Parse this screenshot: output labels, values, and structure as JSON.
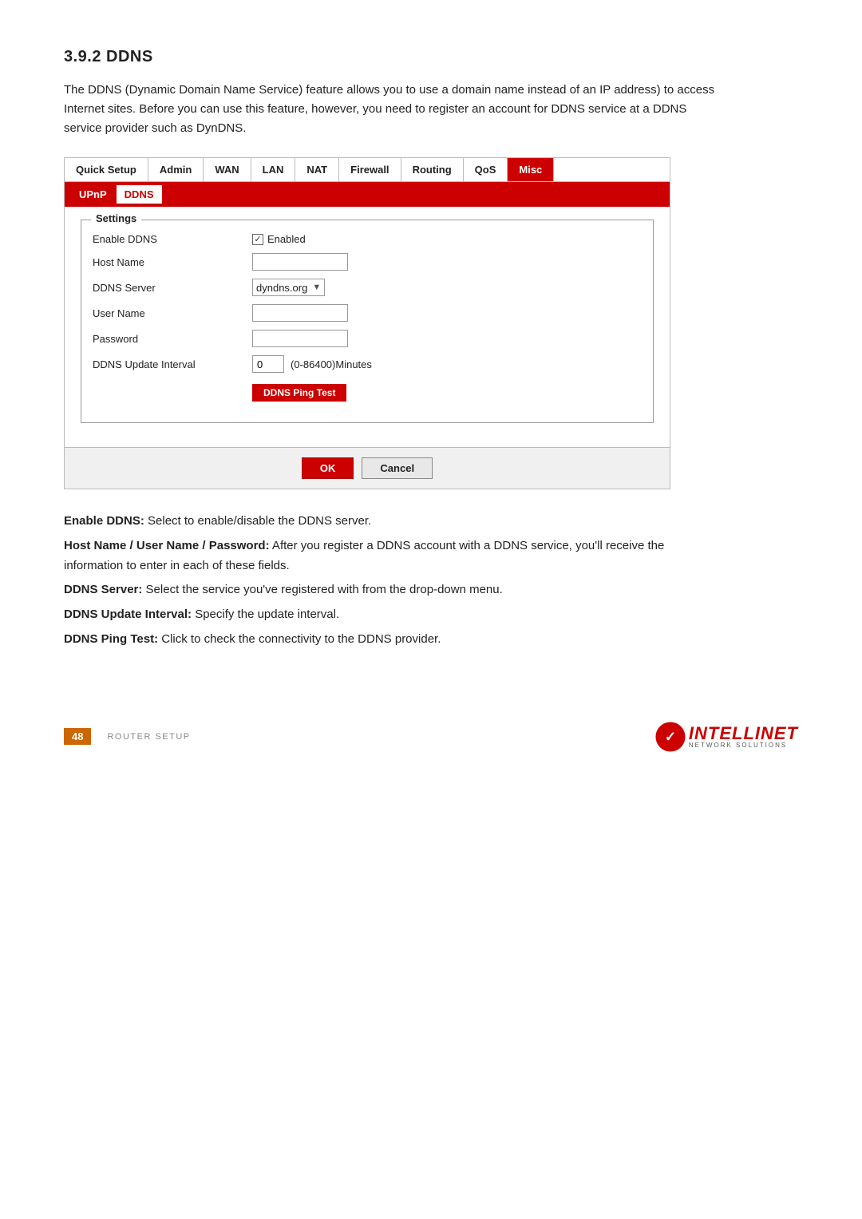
{
  "section": {
    "title": "3.9.2  DDNS",
    "intro": "The DDNS (Dynamic Domain Name Service) feature allows you to use a domain name instead of an IP address) to access Internet sites. Before you can use this feature, however, you need to register an account for DDNS service at a DDNS service provider such as DynDNS."
  },
  "nav": {
    "items": [
      {
        "label": "Quick Setup",
        "active": false
      },
      {
        "label": "Admin",
        "active": false
      },
      {
        "label": "WAN",
        "active": false
      },
      {
        "label": "LAN",
        "active": false
      },
      {
        "label": "NAT",
        "active": false
      },
      {
        "label": "Firewall",
        "active": false
      },
      {
        "label": "Routing",
        "active": false
      },
      {
        "label": "QoS",
        "active": false
      },
      {
        "label": "Misc",
        "active": true
      }
    ]
  },
  "subnav": {
    "items": [
      {
        "label": "UPnP",
        "active": false
      },
      {
        "label": "DDNS",
        "active": true
      }
    ]
  },
  "settings": {
    "legend": "Settings",
    "fields": [
      {
        "label": "Enable DDNS",
        "type": "checkbox",
        "checked": true,
        "checkboxLabel": "Enabled"
      },
      {
        "label": "Host Name",
        "type": "text",
        "value": ""
      },
      {
        "label": "DDNS Server",
        "type": "select",
        "value": "dyndns.org"
      },
      {
        "label": "User Name",
        "type": "text",
        "value": ""
      },
      {
        "label": "Password",
        "type": "password",
        "value": ""
      },
      {
        "label": "DDNS Update Interval",
        "type": "interval",
        "value": "0",
        "hint": "(0-86400)Minutes"
      }
    ],
    "pingButton": "DDNS Ping Test"
  },
  "footer_buttons": {
    "ok": "OK",
    "cancel": "Cancel"
  },
  "descriptions": [
    {
      "term": "Enable DDNS:",
      "text": " Select to enable/disable the DDNS server."
    },
    {
      "term": "Host Name / User Name / Password:",
      "text": " After you register a DDNS account with a DDNS service, you'll receive the information to enter in each of these fields."
    },
    {
      "term": "DDNS Server:",
      "text": " Select the service you've registered with from the drop-down menu."
    },
    {
      "term": "DDNS Update Interval:",
      "text": " Specify the update interval."
    },
    {
      "term": "DDNS Ping Test:",
      "text": " Click to check the connectivity to the DDNS provider."
    }
  ],
  "page_footer": {
    "page_number": "48",
    "label": "ROUTER SETUP"
  },
  "logo": {
    "main": "INTELLINET",
    "sub": "NETWORK  SOLUTIONS"
  }
}
